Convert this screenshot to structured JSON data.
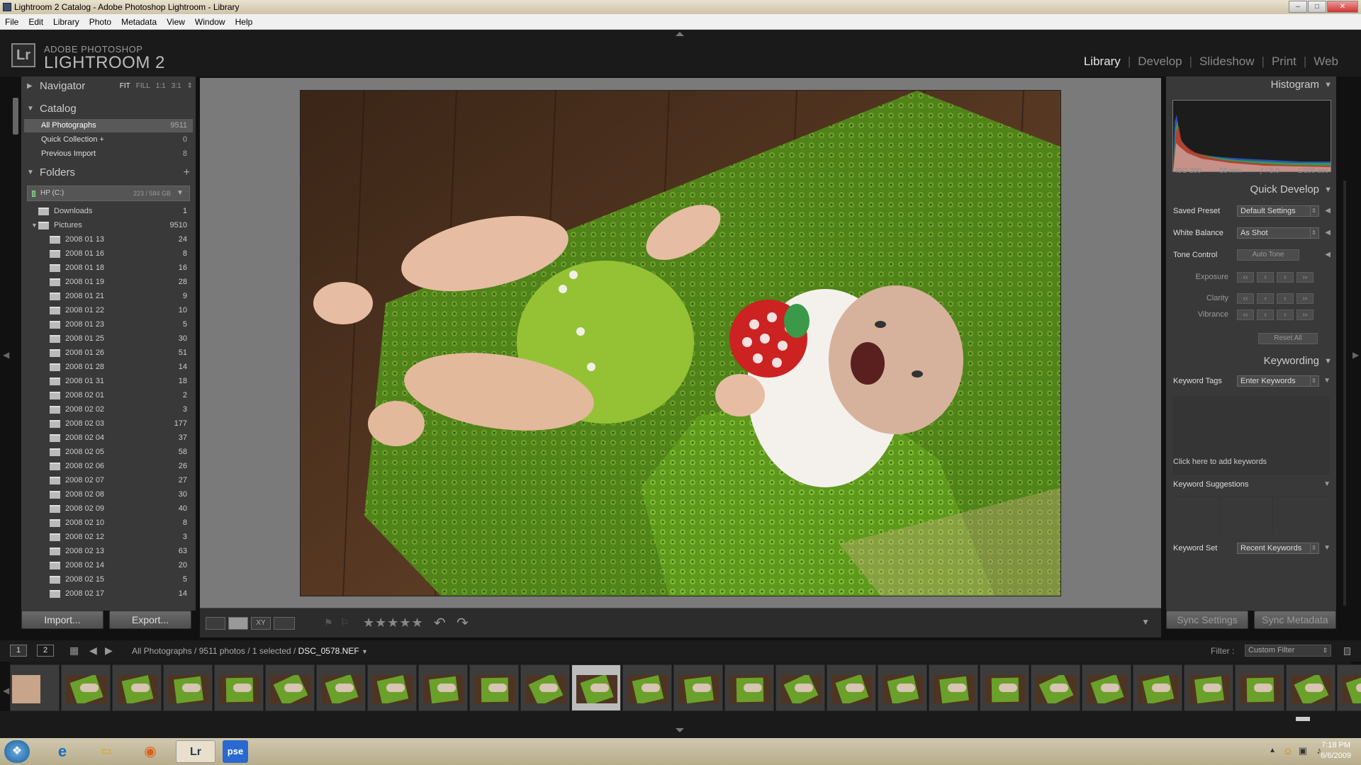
{
  "window": {
    "title": "Lightroom 2 Catalog - Adobe Photoshop Lightroom - Library",
    "controls": [
      "–",
      "□",
      "✕"
    ]
  },
  "menu": [
    "File",
    "Edit",
    "Library",
    "Photo",
    "Metadata",
    "View",
    "Window",
    "Help"
  ],
  "brand": {
    "logo": "Lr",
    "line1": "ADOBE PHOTOSHOP",
    "line2": "LIGHTROOM 2"
  },
  "modules": [
    {
      "label": "Library",
      "active": true
    },
    {
      "label": "Develop",
      "active": false
    },
    {
      "label": "Slideshow",
      "active": false
    },
    {
      "label": "Print",
      "active": false
    },
    {
      "label": "Web",
      "active": false
    }
  ],
  "navigator": {
    "title": "Navigator",
    "options": [
      "FIT",
      "FILL",
      "1:1",
      "3:1"
    ]
  },
  "catalog": {
    "title": "Catalog",
    "items": [
      {
        "label": "All Photographs",
        "count": "9511"
      },
      {
        "label": "Quick Collection  +",
        "count": "0"
      },
      {
        "label": "Previous Import",
        "count": "8"
      }
    ]
  },
  "folders": {
    "title": "Folders",
    "add": "+",
    "drive": {
      "label": "HP (C:)",
      "size": "223 / 584 GB"
    },
    "top": [
      {
        "label": "Downloads",
        "count": "1"
      },
      {
        "label": "Pictures",
        "count": "9510"
      }
    ],
    "sub": [
      {
        "label": "2008 01 13",
        "count": "24"
      },
      {
        "label": "2008 01 16",
        "count": "8"
      },
      {
        "label": "2008 01 18",
        "count": "16"
      },
      {
        "label": "2008 01 19",
        "count": "28"
      },
      {
        "label": "2008 01 21",
        "count": "9"
      },
      {
        "label": "2008 01 22",
        "count": "10"
      },
      {
        "label": "2008 01 23",
        "count": "5"
      },
      {
        "label": "2008 01 25",
        "count": "30"
      },
      {
        "label": "2008 01 26",
        "count": "51"
      },
      {
        "label": "2008 01 28",
        "count": "14"
      },
      {
        "label": "2008 01 31",
        "count": "18"
      },
      {
        "label": "2008 02 01",
        "count": "2"
      },
      {
        "label": "2008 02 02",
        "count": "3"
      },
      {
        "label": "2008 02 03",
        "count": "177"
      },
      {
        "label": "2008 02 04",
        "count": "37"
      },
      {
        "label": "2008 02 05",
        "count": "58"
      },
      {
        "label": "2008 02 06",
        "count": "26"
      },
      {
        "label": "2008 02 07",
        "count": "27"
      },
      {
        "label": "2008 02 08",
        "count": "30"
      },
      {
        "label": "2008 02 09",
        "count": "40"
      },
      {
        "label": "2008 02 10",
        "count": "8"
      },
      {
        "label": "2008 02 12",
        "count": "3"
      },
      {
        "label": "2008 02 13",
        "count": "63"
      },
      {
        "label": "2008 02 14",
        "count": "20"
      },
      {
        "label": "2008 02 15",
        "count": "5"
      },
      {
        "label": "2008 02 17",
        "count": "14"
      }
    ]
  },
  "left_buttons": {
    "import": "Import...",
    "export": "Export..."
  },
  "histogram": {
    "title": "Histogram",
    "iso": "ISO 200",
    "focal": "50 mm",
    "aperture": "ƒ / 5.0",
    "shutter": "1/100 sec"
  },
  "quick_develop": {
    "title": "Quick Develop",
    "saved_preset_label": "Saved Preset",
    "saved_preset_value": "Default Settings",
    "white_balance_label": "White Balance",
    "white_balance_value": "As Shot",
    "tone_control_label": "Tone Control",
    "auto_tone": "Auto Tone",
    "exposure": "Exposure",
    "clarity": "Clarity",
    "vibrance": "Vibrance",
    "reset_all": "Reset All"
  },
  "keywording": {
    "title": "Keywording",
    "tags_label": "Keyword Tags",
    "tags_value": "Enter Keywords",
    "placeholder": "Click here to add keywords",
    "suggestions": "Keyword Suggestions",
    "set_label": "Keyword Set",
    "set_value": "Recent Keywords"
  },
  "right_buttons": {
    "sync_settings": "Sync Settings",
    "sync_metadata": "Sync Metadata"
  },
  "toolbar": {
    "stars": "★★★★★"
  },
  "filmstrip": {
    "pages": [
      "1",
      "2"
    ],
    "source": "All Photographs / 9511 photos / 1 selected / ",
    "filename": "DSC_0578.NEF",
    "filter_label": "Filter :",
    "filter_value": "Custom Filter"
  },
  "taskbar": {
    "clock_time": "7:18 PM",
    "clock_date": "6/6/2009",
    "apps": [
      "Lr",
      "pse"
    ]
  },
  "colors": {
    "accent_green": "#6aa12a",
    "panel": "#393939",
    "background": "#1a1a1a"
  }
}
